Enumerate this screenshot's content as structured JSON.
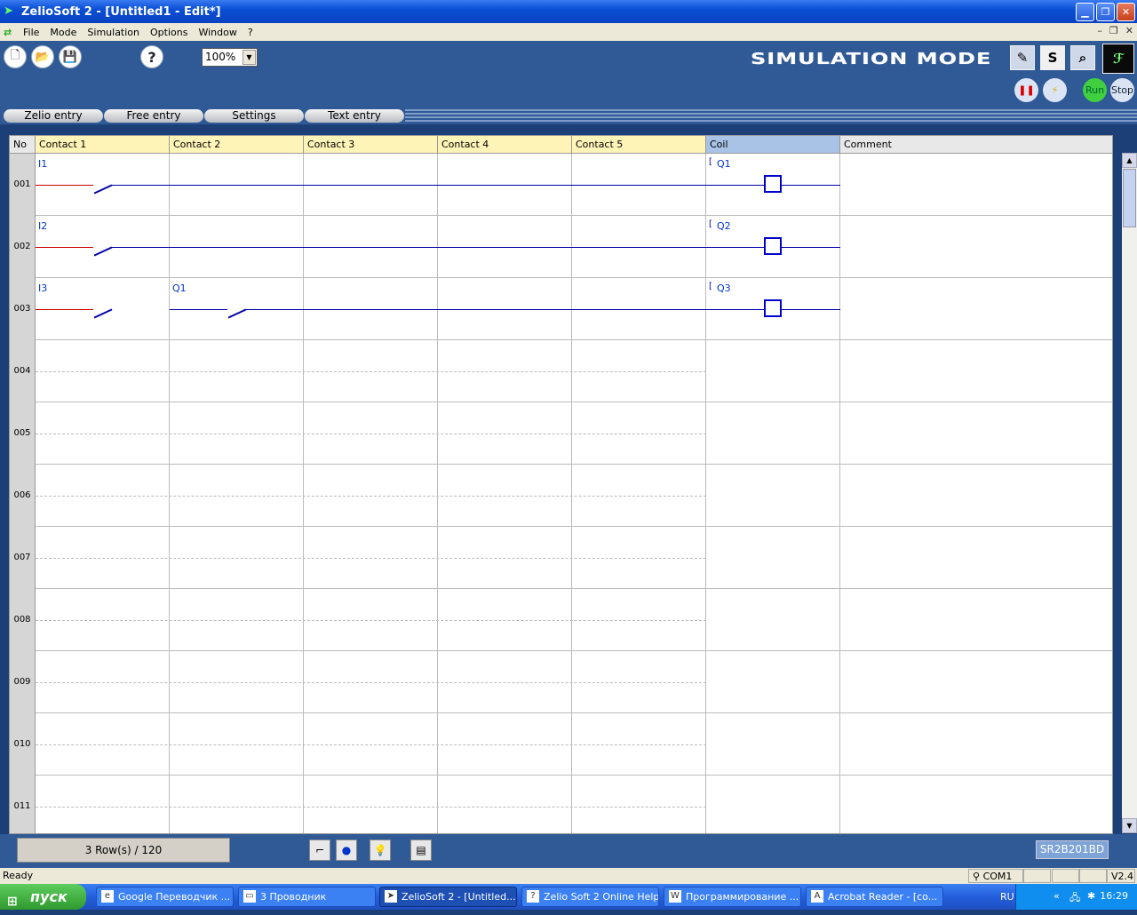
{
  "window": {
    "title": "ZelioSoft 2 - [Untitled1 - Edit*]"
  },
  "menu": {
    "items": [
      "File",
      "Mode",
      "Simulation",
      "Options",
      "Window",
      "?"
    ]
  },
  "toolbar": {
    "zoom_value": "100%",
    "mode_banner": "SIMULATION MODE",
    "run_label": "Run",
    "stop_label": "Stop",
    "s_label": "S",
    "help_label": "?"
  },
  "tabs": [
    "Zelio entry",
    "Free entry",
    "Settings",
    "Text entry"
  ],
  "grid": {
    "headers": [
      "No",
      "Contact 1",
      "Contact 2",
      "Contact 3",
      "Contact 4",
      "Contact 5",
      "Coil",
      "Comment"
    ],
    "row_numbers": [
      "001",
      "002",
      "003",
      "004",
      "005",
      "006",
      "007",
      "008",
      "009",
      "010",
      "011"
    ],
    "rungs": [
      {
        "contacts": [
          "I1"
        ],
        "coil": "Q1"
      },
      {
        "contacts": [
          "I2"
        ],
        "coil": "Q2"
      },
      {
        "contacts": [
          "I3",
          "Q1"
        ],
        "coil": "Q3"
      }
    ]
  },
  "bottom": {
    "row_count": "3 Row(s) / 120",
    "model": "SR2B201BD"
  },
  "status": {
    "ready": "Ready",
    "port": "COM1",
    "version": "V2.4"
  },
  "taskbar": {
    "start": "пуск",
    "tasks": [
      "Google Переводчик ...",
      "3 Проводник",
      "ZelioSoft 2 - [Untitled...",
      "Zelio Soft 2 Online Help",
      "Программирование ...",
      "Acrobat Reader - [co..."
    ],
    "lang": "RU",
    "clock": "16:29"
  },
  "colors": {
    "toolbar_bg": "#2f5a96",
    "contact_header": "#fff4b8",
    "coil_header": "#a9c3e6",
    "wire": "#0000aa",
    "active_wire": "#cc0000"
  }
}
